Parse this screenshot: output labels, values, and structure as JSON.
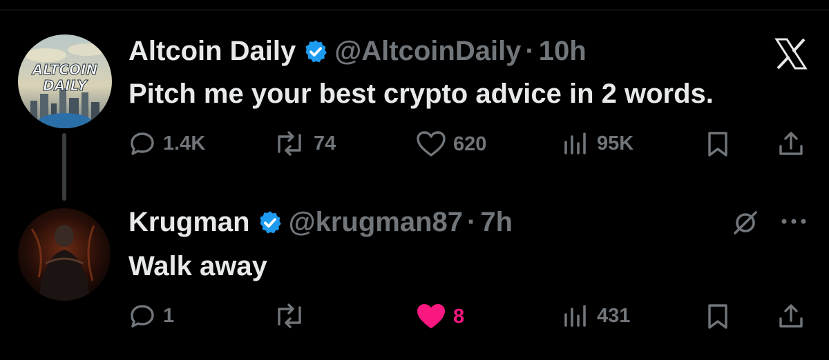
{
  "brand": {
    "x_logo": "x-logo-icon"
  },
  "tweets": [
    {
      "avatar_text": [
        "ALTCOIN",
        "DAILY"
      ],
      "display_name": "Altcoin Daily",
      "handle": "@AltcoinDaily",
      "separator": "·",
      "time": "10h",
      "text": "Pitch me your best crypto advice in 2 words.",
      "actions": {
        "replies": "1.4K",
        "reposts": "74",
        "likes": "620",
        "views": "95K"
      },
      "liked": false
    },
    {
      "display_name": "Krugman",
      "handle": "@krugman87",
      "separator": "·",
      "time": "7h",
      "text": "Walk away",
      "actions": {
        "replies": "1",
        "reposts": "",
        "likes": "8",
        "views": "431"
      },
      "liked": true
    }
  ],
  "colors": {
    "background": "#000000",
    "text": "#e7e9ea",
    "muted": "#71767b",
    "verified": "#1d9bf0",
    "like": "#f91880"
  }
}
